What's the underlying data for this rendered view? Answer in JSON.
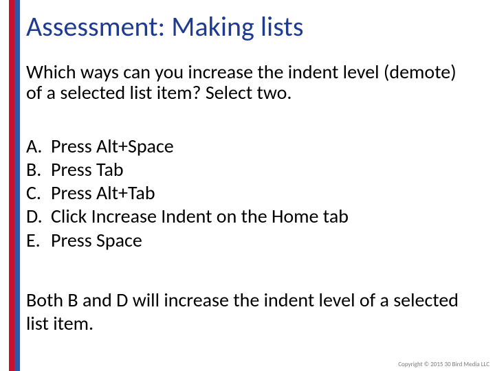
{
  "title": "Assessment: Making lists",
  "question": "Which ways can you increase the indent level (demote) of a selected list item? Select two.",
  "options": [
    {
      "label": "A.",
      "text": "Press Alt+Space"
    },
    {
      "label": "B.",
      "text": "Press Tab"
    },
    {
      "label": "C.",
      "text": "Press Alt+Tab"
    },
    {
      "label": "D.",
      "text": "Click Increase Indent on the Home tab"
    },
    {
      "label": "E.",
      "text": "Press Space"
    }
  ],
  "answer": "Both B and D will increase the indent level of a selected list item.",
  "copyright": "Copyright © 2015 30 Bird Media LLC"
}
